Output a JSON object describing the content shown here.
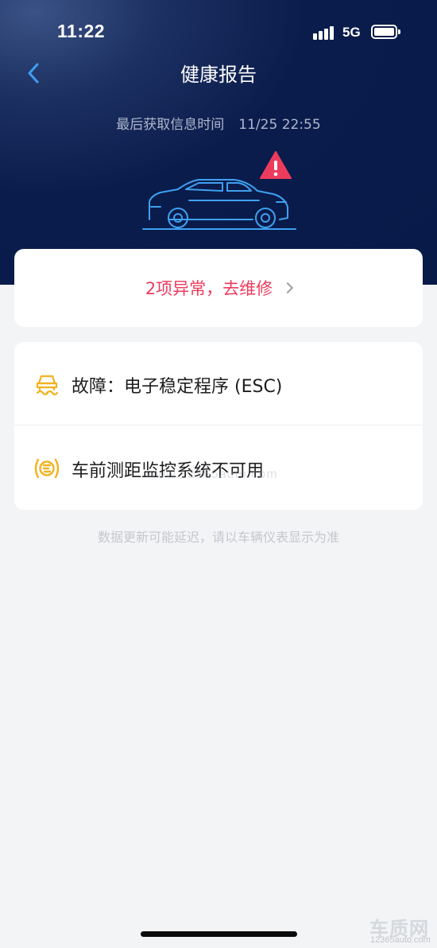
{
  "status_bar": {
    "time": "11:22",
    "network": "5G",
    "icons": [
      "signal-icon",
      "battery-icon"
    ]
  },
  "header": {
    "back_icon": "chevron-left-icon",
    "title": "健康报告",
    "last_fetch_label": "最后获取信息时间",
    "last_fetch_time": "11/25 22:55",
    "illustration_icons": [
      "car-outline-icon",
      "warning-triangle-icon"
    ]
  },
  "alert": {
    "text": "2项异常，去维修",
    "icon": "chevron-right-icon",
    "color": "#ec3b5c"
  },
  "faults": [
    {
      "icon": "esc-skid-warning-icon",
      "text": "故障：电子稳定程序 (ESC)"
    },
    {
      "icon": "front-distance-monitor-icon",
      "text": "车前测距监控系统不可用"
    }
  ],
  "note": "数据更新可能延迟，请以车辆仪表显示为准",
  "watermark": {
    "brand": "车质网",
    "url": "12365auto.com",
    "overlay": "www.12365auto.com"
  },
  "colors": {
    "header_bg": "#0a1c4c",
    "accent_blue": "#3fa0f0",
    "warning_red": "#ec3b5c",
    "icon_yellow": "#f2b21e",
    "page_bg": "#f3f4f6"
  }
}
